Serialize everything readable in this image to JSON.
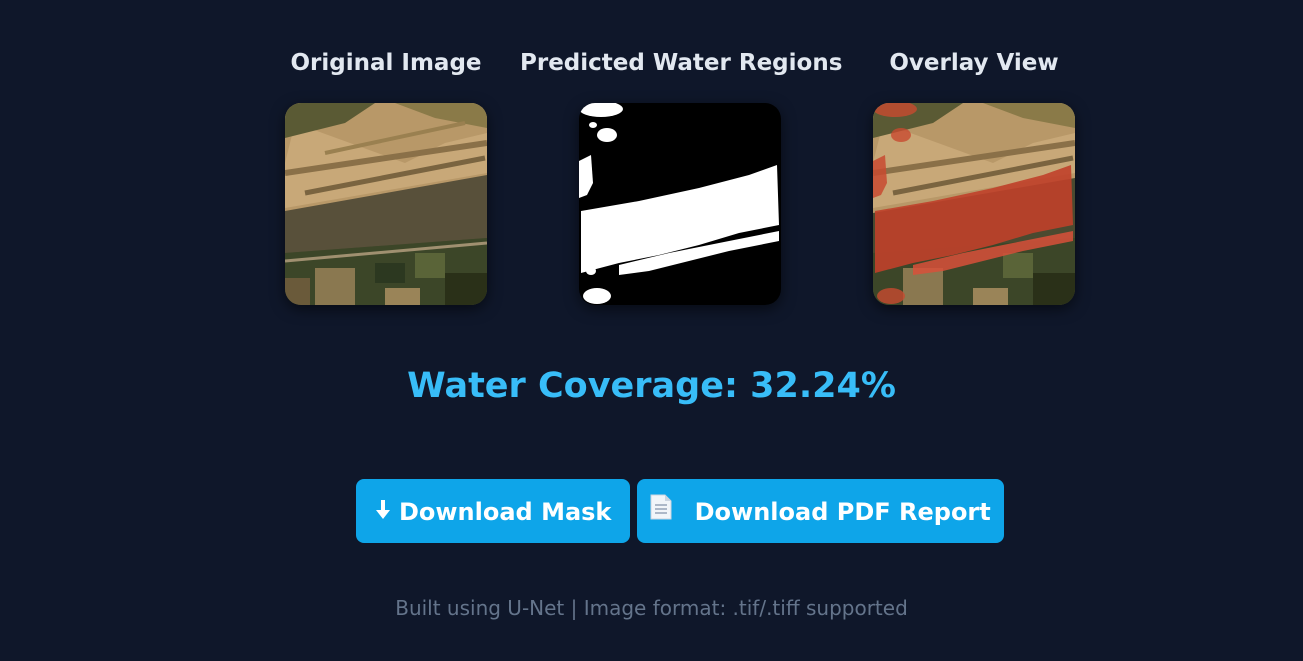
{
  "panels": [
    {
      "title": "Original Image"
    },
    {
      "title": "Predicted Water Regions"
    },
    {
      "title": "Overlay View"
    }
  ],
  "result": {
    "coverage_text": "Water Coverage: 32.24%",
    "coverage_percent": 32.24
  },
  "actions": {
    "download_mask_label": "Download Mask",
    "download_pdf_label": "Download PDF Report"
  },
  "icons": {
    "download_mask": "down-arrow-icon",
    "download_pdf": "document-icon"
  },
  "footer": {
    "text": "Built using U-Net | Image format: .tif/.tiff supported"
  },
  "colors": {
    "background": "#0f172a",
    "accent": "#38bdf8",
    "button": "#0ea5e9",
    "title": "#e2e8f0",
    "footer": "#64748b"
  }
}
